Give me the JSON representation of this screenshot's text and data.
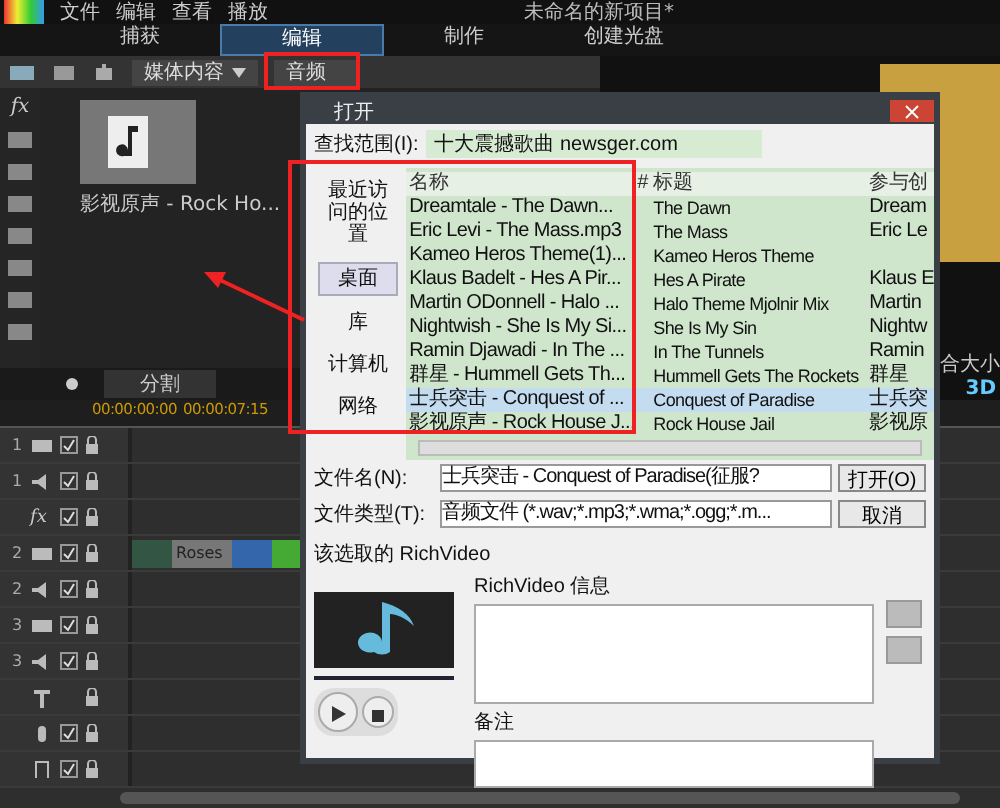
{
  "window": {
    "title": "未命名的新项目*"
  },
  "menu": [
    "文件",
    "编辑",
    "查看",
    "播放"
  ],
  "tabs": [
    {
      "label": "捕获",
      "selected": false
    },
    {
      "label": "编辑",
      "selected": true
    },
    {
      "label": "制作",
      "selected": false
    },
    {
      "label": "创建光盘",
      "selected": false
    }
  ],
  "library": {
    "filter": "媒体内容",
    "category": "音频",
    "effects_label": "fx",
    "items": [
      {
        "label": "影视原声 - Rock Ho..."
      }
    ]
  },
  "split_button": "分割",
  "preview": {
    "fit": "合大小",
    "mode": "3D"
  },
  "timeline": {
    "ticks": [
      "00:00:00:00",
      "00:00:07:15"
    ],
    "tracks": [
      {
        "kind": "video",
        "number": "1",
        "checked": true,
        "clips": false
      },
      {
        "kind": "audio",
        "number": "1",
        "checked": true,
        "clips": false
      },
      {
        "kind": "fx",
        "label": "fx",
        "checked": true,
        "clips": false
      },
      {
        "kind": "video",
        "number": "2",
        "checked": true,
        "clips": true
      },
      {
        "kind": "audio",
        "number": "2",
        "checked": true,
        "clips": false
      },
      {
        "kind": "video",
        "number": "3",
        "checked": true,
        "clips": false
      },
      {
        "kind": "audio",
        "number": "3",
        "checked": true,
        "clips": false
      },
      {
        "kind": "title",
        "checked": false,
        "clips": false
      },
      {
        "kind": "voice",
        "checked": true,
        "clips": false
      },
      {
        "kind": "music",
        "checked": true,
        "clips": false
      }
    ],
    "clip_label": "Roses"
  },
  "dialog": {
    "title": "打开",
    "look_in_label": "查找范围(I):",
    "look_in": "十大震撼歌曲 newsger.com",
    "places": [
      {
        "label": "最近访问的位置",
        "selected": false
      },
      {
        "label": "桌面",
        "selected": true
      },
      {
        "label": "库",
        "selected": false
      },
      {
        "label": "计算机",
        "selected": false
      },
      {
        "label": "网络",
        "selected": false
      }
    ],
    "columns": [
      "名称",
      "#",
      "标题",
      "参与创"
    ],
    "files": [
      {
        "name": "Dreamtale - The Dawn...",
        "title": "The Dawn",
        "artist": "Dream",
        "selected": false
      },
      {
        "name": "Eric Levi - The Mass.mp3",
        "title": "The Mass",
        "artist": "Eric Le",
        "selected": false
      },
      {
        "name": "Kameo Heros Theme(1)...",
        "title": "Kameo Heros Theme",
        "selected": false
      },
      {
        "name": "Klaus Badelt - Hes A Pir...",
        "title": "Hes A Pirate",
        "artist": "Klaus E",
        "selected": false
      },
      {
        "name": "Martin ODonnell - Halo ...",
        "title": "Halo Theme Mjolnir Mix",
        "artist": "Martin",
        "selected": false
      },
      {
        "name": "Nightwish - She Is My Si...",
        "title": "She Is My Sin",
        "artist": "Nightw",
        "selected": false
      },
      {
        "name": "Ramin Djawadi - In The ...",
        "title": "In The Tunnels",
        "artist": "Ramin",
        "selected": false
      },
      {
        "name": "群星 - Hummell Gets Th...",
        "title": "Hummell Gets The Rockets",
        "artist": "群星",
        "selected": false
      },
      {
        "name": "士兵突击 - Conquest of ...",
        "title": "Conquest of Paradise",
        "artist": "士兵突",
        "selected": true
      },
      {
        "name": "影视原声 - Rock House J...",
        "title": "Rock House Jail",
        "artist": "影视原",
        "selected": false
      }
    ],
    "filename_label": "文件名(N):",
    "filename": "士兵突击 - Conquest of Paradise(征服?",
    "filetype_label": "文件类型(T):",
    "filetype": "音频文件 (*.wav;*.mp3;*.wma;*.ogg;*.m...",
    "open_button": "打开(O)",
    "cancel_button": "取消",
    "preview_label": "该选取的 RichVideo",
    "seek": {
      "level": 1
    },
    "info_label": "RichVideo 信息",
    "notes_label": "备注"
  }
}
